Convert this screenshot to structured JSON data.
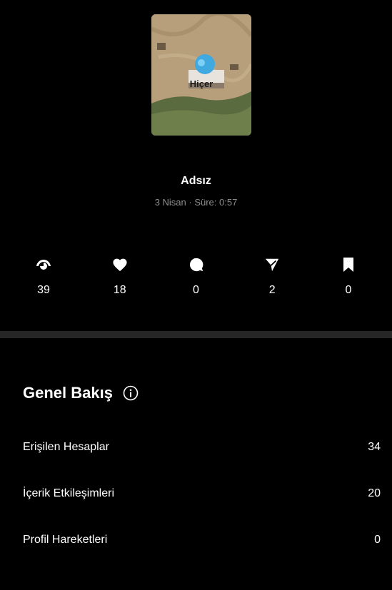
{
  "post": {
    "thumbnail_caption": "Hiçer",
    "title": "Adsız",
    "meta": "3 Nisan · Süre: 0:57"
  },
  "stats": [
    {
      "icon": "eye-icon",
      "value": "39"
    },
    {
      "icon": "heart-icon",
      "value": "18"
    },
    {
      "icon": "comment-icon",
      "value": "0"
    },
    {
      "icon": "share-icon",
      "value": "2"
    },
    {
      "icon": "bookmark-icon",
      "value": "0"
    }
  ],
  "overview": {
    "title": "Genel Bakış",
    "rows": [
      {
        "label": "Erişilen Hesaplar",
        "value": "34"
      },
      {
        "label": "İçerik Etkileşimleri",
        "value": "20"
      },
      {
        "label": "Profil Hareketleri",
        "value": "0"
      }
    ]
  },
  "colors": {
    "background": "#000000",
    "divider": "#262626",
    "meta_text": "#8e8e8e",
    "text": "#ffffff"
  }
}
